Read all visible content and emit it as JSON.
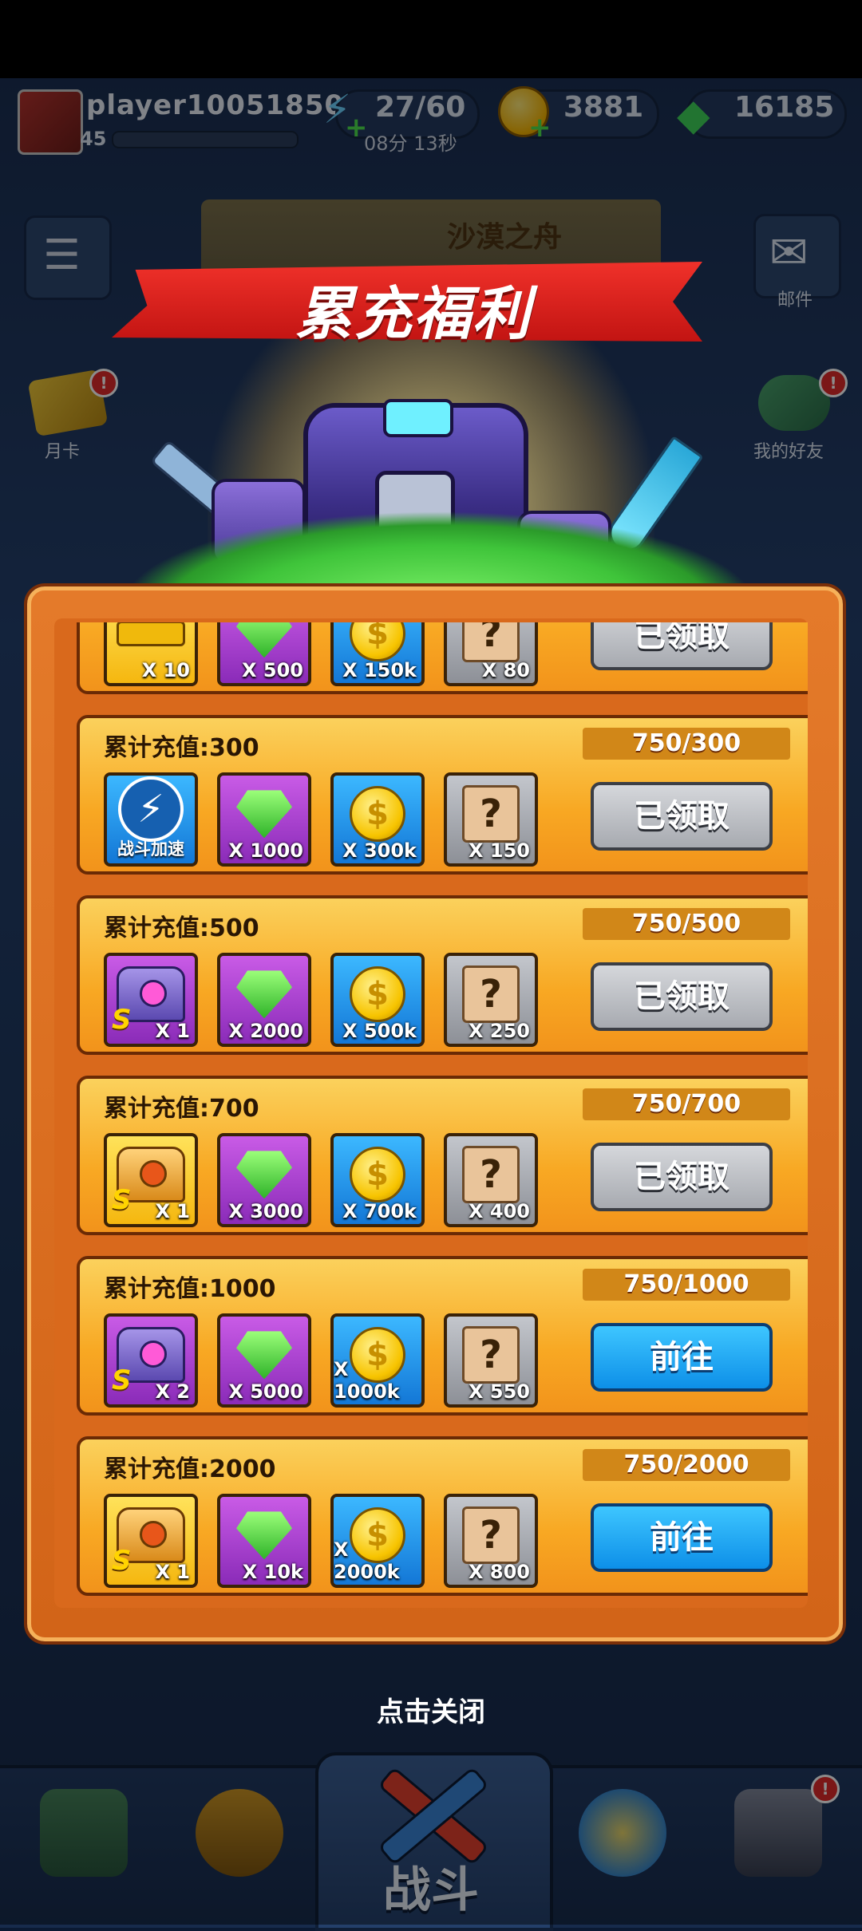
{
  "top_bar": {
    "player_name": "player10051850",
    "level": "45",
    "energy": "27/60",
    "energy_timer": "08分 13秒",
    "coins": "3881",
    "gems": "16185"
  },
  "side": {
    "mail_label": "邮件",
    "month_card_label": "月卡",
    "friends_label": "我的好友"
  },
  "event_banner_title": "沙漠之舟",
  "popup": {
    "title": "累充福利",
    "tap_to_close": "点击关闭",
    "partial_row": {
      "rewards": [
        "X 10",
        "X 500",
        "X 150k",
        "X 80"
      ],
      "button": "已领取"
    },
    "rows": [
      {
        "title": "累计充值:300",
        "progress": "750/300",
        "rewards": [
          {
            "type": "boost",
            "label": "战斗加速",
            "qty": ""
          },
          {
            "type": "gem",
            "qty": "X 1000"
          },
          {
            "type": "coin",
            "qty": "X 300k"
          },
          {
            "type": "mystery",
            "qty": "X 150"
          }
        ],
        "button": "已领取",
        "state": "claimed"
      },
      {
        "title": "累计充值:500",
        "progress": "750/500",
        "rewards": [
          {
            "type": "chest-purple",
            "qty": "X 1"
          },
          {
            "type": "gem",
            "qty": "X 2000"
          },
          {
            "type": "coin",
            "qty": "X 500k"
          },
          {
            "type": "mystery",
            "qty": "X 250"
          }
        ],
        "button": "已领取",
        "state": "claimed"
      },
      {
        "title": "累计充值:700",
        "progress": "750/700",
        "rewards": [
          {
            "type": "chest-gold",
            "qty": "X 1"
          },
          {
            "type": "gem",
            "qty": "X 3000"
          },
          {
            "type": "coin",
            "qty": "X 700k"
          },
          {
            "type": "mystery",
            "qty": "X 400"
          }
        ],
        "button": "已领取",
        "state": "claimed"
      },
      {
        "title": "累计充值:1000",
        "progress": "750/1000",
        "rewards": [
          {
            "type": "chest-purple",
            "qty": "X 2"
          },
          {
            "type": "gem",
            "qty": "X 5000"
          },
          {
            "type": "coin",
            "qty": "X 1000k"
          },
          {
            "type": "mystery",
            "qty": "X 550"
          }
        ],
        "button": "前往",
        "state": "go"
      },
      {
        "title": "累计充值:2000",
        "progress": "750/2000",
        "rewards": [
          {
            "type": "chest-gold",
            "qty": "X 1"
          },
          {
            "type": "gem",
            "qty": "X 10k"
          },
          {
            "type": "coin",
            "qty": "X 2000k"
          },
          {
            "type": "mystery",
            "qty": "X 800"
          }
        ],
        "button": "前往",
        "state": "go"
      }
    ]
  },
  "bottom_nav": {
    "battle_label": "战斗"
  },
  "colors": {
    "panel": "#e47a2a",
    "row": "#f8a823",
    "claimed_button": "#a7aab0",
    "go_button": "#0d8fe8",
    "ribbon": "#c21412"
  }
}
